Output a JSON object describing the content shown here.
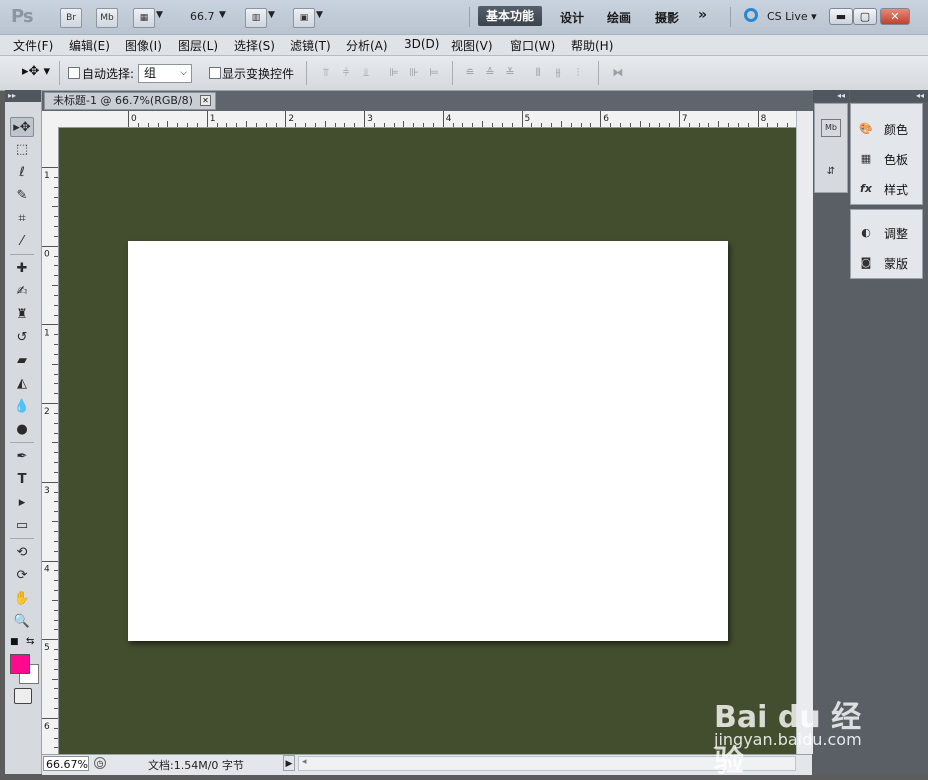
{
  "app": {
    "logo": "Ps"
  },
  "titlebar": {
    "br": "Br",
    "mb": "Mb",
    "zoom": "66.7",
    "workspaces": [
      "基本功能",
      "设计",
      "绘画",
      "摄影"
    ],
    "more": "»",
    "cslive": "CS Live"
  },
  "menu": [
    "文件(F)",
    "编辑(E)",
    "图像(I)",
    "图层(L)",
    "选择(S)",
    "滤镜(T)",
    "分析(A)",
    "3D(D)",
    "视图(V)",
    "窗口(W)",
    "帮助(H)"
  ],
  "options": {
    "auto_select_label": "自动选择:",
    "auto_select_value": "组",
    "show_transform_label": "显示变换控件"
  },
  "document": {
    "tab_title": "未标题-1 @ 66.7%(RGB/8)",
    "zoom_field": "66.67%",
    "info": "文档:1.54M/0 字节",
    "canvas_bg": "#434e2f",
    "ruler_h_labels": [
      "0",
      "1",
      "2",
      "3",
      "4",
      "5",
      "6",
      "7",
      "8"
    ],
    "ruler_v_labels": [
      "1",
      "0",
      "1",
      "2",
      "3",
      "4",
      "5",
      "6"
    ]
  },
  "colors": {
    "foreground": "#ff0a8e",
    "background": "#ffffff"
  },
  "panels": {
    "group1": [
      {
        "label": "颜色",
        "icon": "palette-icon"
      },
      {
        "label": "色板",
        "icon": "swatches-icon"
      },
      {
        "label": "样式",
        "icon": "fx-styles-icon"
      }
    ],
    "group2": [
      {
        "label": "调整",
        "icon": "adjustment-icon"
      },
      {
        "label": "蒙版",
        "icon": "mask-icon"
      }
    ]
  },
  "watermark": {
    "brand": "Bai du 经验",
    "url": "jingyan.baidu.com"
  }
}
